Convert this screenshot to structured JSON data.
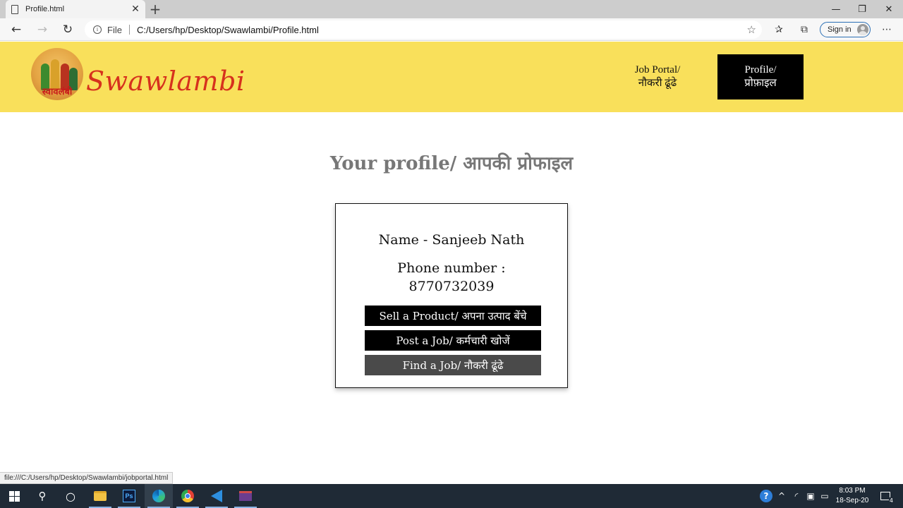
{
  "browser": {
    "tab_title": "Profile.html",
    "file_label": "File",
    "url": "C:/Users/hp/Desktop/Swawlambi/Profile.html",
    "signin_label": "Sign in",
    "status_url": "file:///C:/Users/hp/Desktop/Swawlambi/jobportal.html"
  },
  "header": {
    "logo_hindi": "स्वावलंबी",
    "brand": "Swawlambi",
    "nav": [
      {
        "label": "Job Portal/\nनौकरी ढूंढे",
        "active": false
      },
      {
        "label": "Profile/\nप्रोफ़ाइल",
        "active": true
      }
    ]
  },
  "main": {
    "title": "Your profile/ आपकी प्रोफाइल",
    "card": {
      "name": "Name - Sanjeeb Nath",
      "phone_label": "Phone number :",
      "phone_value": "8770732039",
      "buttons": [
        {
          "label": "Sell a Product/ अपना उत्पाद बेंचे"
        },
        {
          "label": "Post a Job/ कर्मचारी खोजें"
        },
        {
          "label": "Find a Job/ नौकरी ढूंढे"
        }
      ]
    }
  },
  "taskbar": {
    "time": "8:03 PM",
    "date": "18-Sep-20",
    "notification_count": "4"
  },
  "colors": {
    "header_bg": "#f9e05b",
    "brand": "#d6311d",
    "title": "#777777",
    "button": "#000000",
    "button_hover": "#4a4a4a"
  }
}
